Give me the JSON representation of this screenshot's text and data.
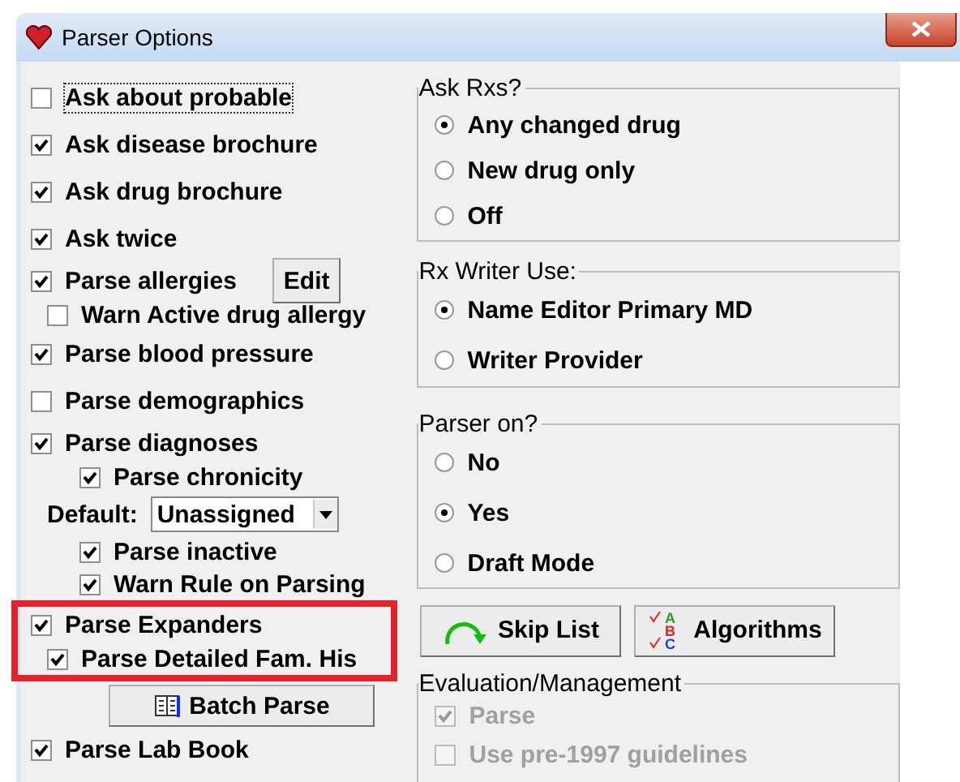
{
  "window": {
    "title": "Parser Options"
  },
  "left_options": [
    {
      "kind": "checkbox",
      "label": "Ask about probable",
      "checked": false,
      "focused": true
    },
    {
      "kind": "checkbox",
      "label": "Ask disease brochure",
      "checked": true
    },
    {
      "kind": "checkbox",
      "label": "Ask drug brochure",
      "checked": true
    },
    {
      "kind": "checkbox",
      "label": "Ask twice",
      "checked": true
    },
    {
      "kind": "checkbox",
      "label": "Parse allergies",
      "checked": true,
      "button": "Edit",
      "children": [
        {
          "kind": "checkbox",
          "label": "Warn Active drug allergy",
          "checked": false
        }
      ]
    },
    {
      "kind": "checkbox",
      "label": "Parse blood pressure",
      "checked": true
    },
    {
      "kind": "checkbox",
      "label": "Parse demographics",
      "checked": false
    },
    {
      "kind": "checkbox",
      "label": "Parse diagnoses",
      "checked": true,
      "children": [
        {
          "kind": "checkbox",
          "label": "Parse chronicity",
          "checked": true
        },
        {
          "kind": "dropdown",
          "label": "Default:",
          "value": "Unassigned"
        },
        {
          "kind": "checkbox",
          "label": "Parse inactive",
          "checked": true
        },
        {
          "kind": "checkbox",
          "label": "Warn Rule on Parsing",
          "checked": true
        }
      ]
    },
    {
      "kind": "checkbox",
      "label": "Parse Expanders",
      "checked": true,
      "highlighted": true,
      "children": [
        {
          "kind": "checkbox",
          "label": "Parse Detailed Fam. His",
          "checked": true
        }
      ]
    },
    {
      "kind": "button",
      "label": "Batch Parse"
    },
    {
      "kind": "checkbox",
      "label": "Parse Lab Book",
      "checked": true
    }
  ],
  "groups": [
    {
      "title": "Ask Rxs?",
      "options": [
        {
          "label": "Any changed drug",
          "selected": true
        },
        {
          "label": "New drug only",
          "selected": false
        },
        {
          "label": "Off",
          "selected": false
        }
      ]
    },
    {
      "title": "Rx Writer Use:",
      "options": [
        {
          "label": "Name Editor Primary MD",
          "selected": true
        },
        {
          "label": "Writer Provider",
          "selected": false
        }
      ]
    },
    {
      "title": "Parser on?",
      "options": [
        {
          "label": "No",
          "selected": false
        },
        {
          "label": "Yes",
          "selected": true
        },
        {
          "label": "Draft Mode",
          "selected": false
        }
      ]
    }
  ],
  "buttons": [
    {
      "kind": "skip",
      "label": "Skip List"
    },
    {
      "kind": "algorithms",
      "label": "Algorithms",
      "icon_letters": [
        "A",
        "B",
        "C"
      ]
    }
  ],
  "evaluation": {
    "title": "Evaluation/Management",
    "options": [
      {
        "label": "Parse",
        "checked": true,
        "disabled": true
      },
      {
        "label": "Use pre-1997 guidelines",
        "checked": false,
        "disabled": true
      }
    ]
  }
}
